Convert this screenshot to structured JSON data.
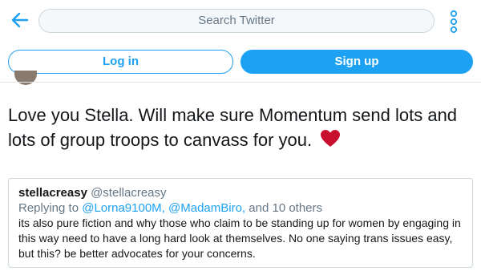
{
  "header": {
    "search_placeholder": "Search Twitter",
    "back_icon": "arrow-left-icon",
    "more_icon": "vertical-dots-icon"
  },
  "auth": {
    "login_label": "Log in",
    "signup_label": "Sign up"
  },
  "tweet": {
    "text": "Love you Stella. Will make sure Momentum send lots and lots of group troops to canvass for you.",
    "emoji": "heart-icon"
  },
  "quoted_tweet": {
    "display_name": "stellacreasy",
    "handle": "@stellacreasy",
    "replying_prefix": "Replying to",
    "replying_links": "@Lorna9100M, @MadamBiro,",
    "replying_suffix": "and 10 others",
    "text": "its also pure fiction and why those who claim to be standing up for women by engaging in this way need to have a long hard look at themselves. No one saying trans issues easy, but this? be better advocates for your concerns."
  },
  "colors": {
    "accent": "#1da1f2",
    "heart": "#e0245e",
    "secondary_text": "#657786",
    "border": "#ccd6dd"
  }
}
